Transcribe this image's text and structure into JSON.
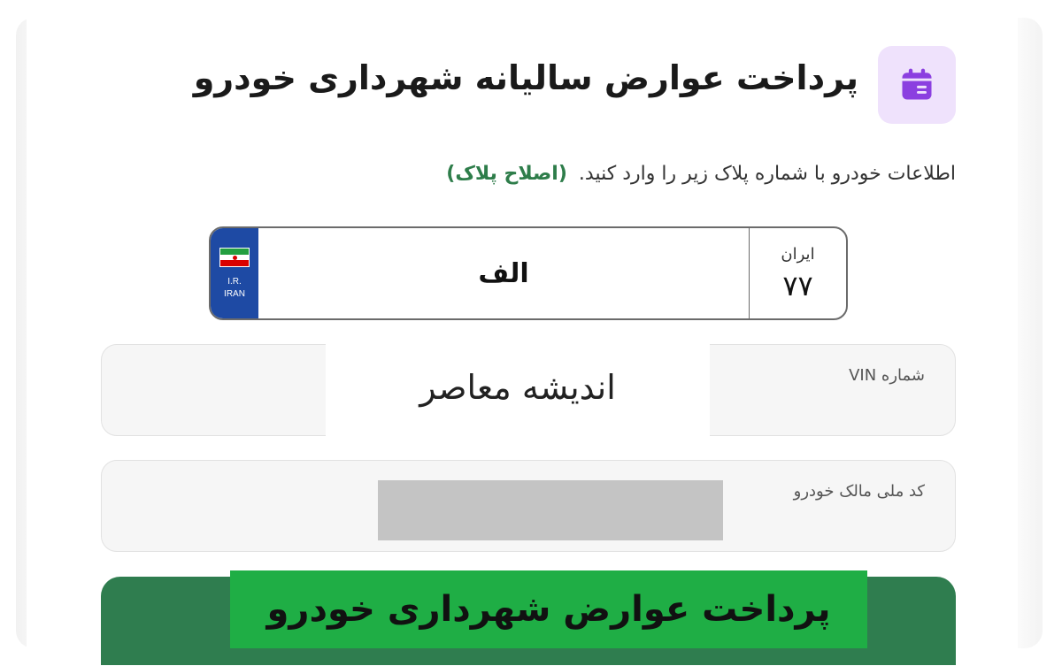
{
  "header": {
    "title": "پرداخت عوارض سالیانه شهرداری خودرو",
    "icon": "calendar-icon",
    "icon_color": "#8b3fe0",
    "icon_bg": "#efe2fc"
  },
  "intro": {
    "text": "اطلاعات خودرو با شماره پلاک زیر را وارد کنید.",
    "link": "(اصلاح پلاک)",
    "link_color": "#2e7d4a"
  },
  "plate": {
    "letter": "الف",
    "country_label": "ایران",
    "region_code": "۷۷",
    "ir_line1": "I.R.",
    "ir_line2": "IRAN"
  },
  "fields": {
    "vin_label": "شماره VIN",
    "owner_label": "کد ملی مالک خودرو"
  },
  "watermark": {
    "text": "اندیشه معاصر"
  },
  "banner": {
    "text": "پرداخت عوارض شهرداری خودرو",
    "bg": "#1fae45"
  },
  "colors": {
    "button": "#2f7d4f",
    "plate_blue": "#1e4aa4"
  }
}
